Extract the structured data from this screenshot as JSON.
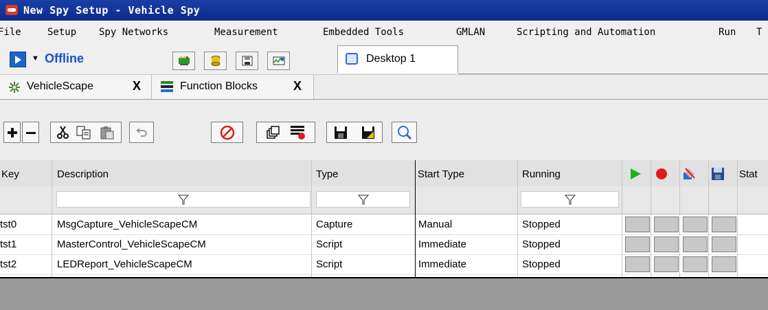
{
  "window": {
    "title": "New Spy Setup - Vehicle Spy"
  },
  "menu": [
    "File",
    "Setup",
    "Spy Networks",
    "Measurement",
    "Embedded Tools",
    "GMLAN",
    "Scripting and Automation",
    "Run",
    "T"
  ],
  "toolbar": {
    "status": "Offline",
    "buttons": [
      "network-icon",
      "database-icon",
      "save-disk-icon",
      "message-view-icon"
    ],
    "desktop_tab": "Desktop 1"
  },
  "tabs": [
    {
      "label": "VehicleScape",
      "close": "X",
      "icon": "vehiclescape-icon"
    },
    {
      "label": "Function Blocks",
      "close": "X",
      "icon": "function-blocks-icon"
    }
  ],
  "iconbar": [
    "add-icon",
    "remove-icon",
    "cut-icon",
    "copy-icon",
    "paste-icon",
    "undo-icon",
    "disable-icon",
    "window-icon",
    "script-icon",
    "save-icon",
    "save-as-icon",
    "search-icon"
  ],
  "table": {
    "headers": [
      "Key",
      "Description",
      "Type",
      "Start Type",
      "Running",
      "Stat"
    ],
    "rows": [
      {
        "key": "tst0",
        "description": "MsgCapture_VehicleScapeCM",
        "type": "Capture",
        "start_type": "Manual",
        "running": "Stopped"
      },
      {
        "key": "tst1",
        "description": "MasterControl_VehicleScapeCM",
        "type": "Script",
        "start_type": "Immediate",
        "running": "Stopped"
      },
      {
        "key": "tst2",
        "description": "LEDReport_VehicleScapeCM",
        "type": "Script",
        "start_type": "Immediate",
        "running": "Stopped"
      }
    ],
    "action_icons": [
      "start-icon",
      "record-icon",
      "clear-icon",
      "save-icon"
    ]
  },
  "colors": {
    "titlebar": "#0b2a8c",
    "status": "#1a4fd0",
    "start_green": "#1fb11f",
    "record_red": "#e11b1b"
  }
}
